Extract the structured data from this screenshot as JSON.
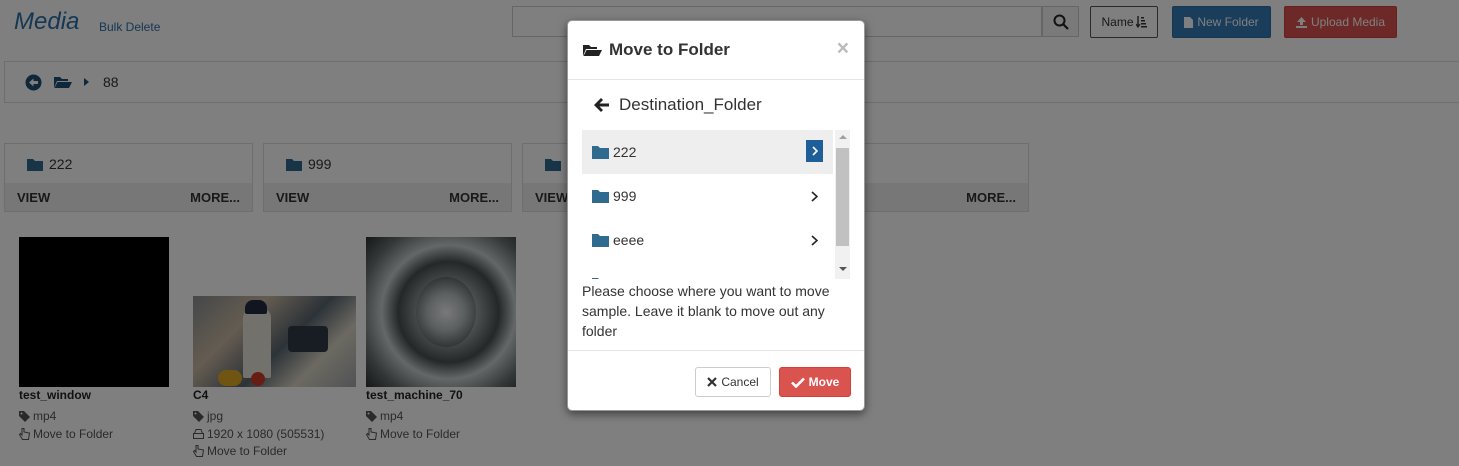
{
  "header": {
    "title": "Media",
    "bulk_delete": "Bulk Delete",
    "search_placeholder": "",
    "sort_label": "Name",
    "new_folder_label": "New Folder",
    "upload_label": "Upload Media"
  },
  "breadcrumb": {
    "current": "88"
  },
  "folders": [
    {
      "name": "222",
      "view": "VIEW",
      "more": "MORE..."
    },
    {
      "name": "999",
      "view": "VIEW",
      "more": "MORE..."
    },
    {
      "name": "",
      "view": "VIEW",
      "more": ""
    },
    {
      "name": "",
      "view": "",
      "more": "MORE..."
    }
  ],
  "media": [
    {
      "name": "test_window",
      "type": "mp4",
      "action": "Move to Folder"
    },
    {
      "name": "C4",
      "type": "jpg",
      "dimensions": "1920 x 1080 (505531)",
      "action": "Move to Folder"
    },
    {
      "name": "test_machine_70",
      "type": "mp4",
      "action": "Move to Folder"
    }
  ],
  "modal": {
    "title": "Move to Folder",
    "close": "×",
    "destination": "Destination_Folder",
    "folders": [
      "222",
      "999",
      "eeee",
      "ffff"
    ],
    "help_text": "Please choose where you want to move sample. Leave it blank to move out any folder",
    "cancel_label": "Cancel",
    "move_label": "Move"
  },
  "colors": {
    "accent_blue": "#337ab7",
    "danger_red": "#d9534f",
    "folder_icon": "#2f6b8f",
    "title_blue": "#2a6ea8"
  }
}
